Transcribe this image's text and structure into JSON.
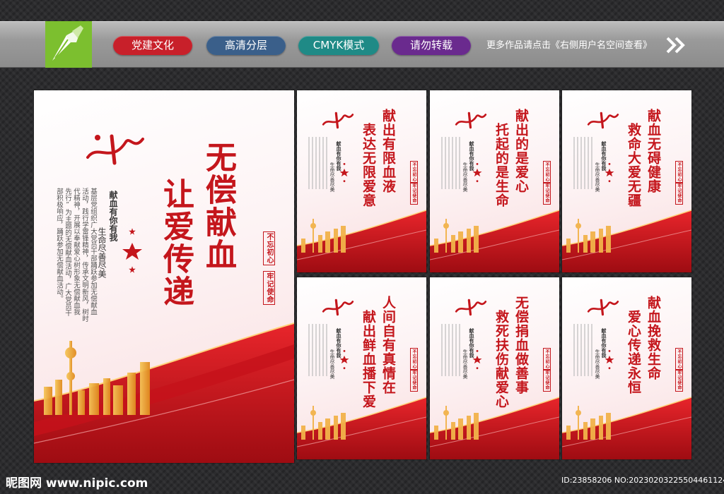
{
  "header": {
    "tags": [
      {
        "label": "党建文化",
        "color": "#c8202a"
      },
      {
        "label": "高清分层",
        "color": "#3a5f8a"
      },
      {
        "label": "CMYK模式",
        "color": "#1f8a86"
      },
      {
        "label": "请勿转载",
        "color": "#6a2a8e"
      }
    ],
    "notice": "更多作品请点击《右侧用户名空间查看》"
  },
  "main_poster": {
    "title_col1": "无偿献血",
    "title_col2": "让爱传递",
    "slogan_col1": "献血有你有我",
    "slogan_col2": "生命尽善尽美",
    "body_lines": [
      "基层党组织广大党员干部踊跃参加无偿献血",
      "活动，践行学雷锋精神，传承文明新风，树时",
      "代精神，开展以奉献爱心树形象无偿献血我",
      "先行”为主题的无偿献血活动，广大党员干",
      "部积极响应，踊跃参加无偿献血活动。"
    ],
    "seal_1": "不忘初心",
    "seal_2": "牢记使命"
  },
  "small_posters": [
    {
      "title_col1": "献出有限血液",
      "title_col2": "表达无限爱意"
    },
    {
      "title_col1": "献出的是爱心",
      "title_col2": "托起的是生命"
    },
    {
      "title_col1": "献血无碍健康",
      "title_col2": "救命大爱无疆"
    },
    {
      "title_col1": "人间自有真情在",
      "title_col2": "献出鲜血播下爱"
    },
    {
      "title_col1": "无偿捐血做善事",
      "title_col2": "救死扶伤献爱心"
    },
    {
      "title_col1": "献血挽救生命",
      "title_col2": "爱心传递永恒"
    }
  ],
  "small_common": {
    "slogan_col1": "献血有你有我",
    "slogan_col2": "生命尽善尽美",
    "seal_1": "不忘初心",
    "seal_2": "牢记使命"
  },
  "footer": {
    "site": "昵图网 www.nipic.com",
    "id_text": "ID:23858206 NO:20230203225504461124"
  }
}
